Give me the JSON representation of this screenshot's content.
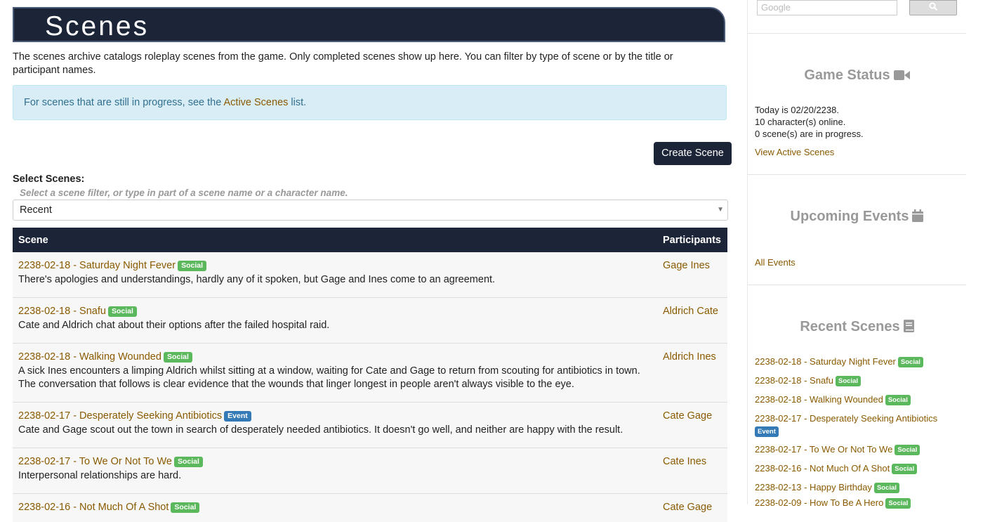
{
  "header": {
    "title": "Scenes"
  },
  "intro": "The scenes archive catalogs roleplay scenes from the game. Only completed scenes show up here. You can filter by type of scene or by the title or participant names.",
  "info": {
    "prefix": "For scenes that are still in progress, see the ",
    "link": "Active Scenes",
    "suffix": " list."
  },
  "create_button": "Create Scene",
  "filter": {
    "label": "Select Scenes:",
    "hint": "Select a scene filter, or type in part of a scene name or a character name.",
    "selected": "Recent"
  },
  "table": {
    "headers": {
      "scene": "Scene",
      "participants": "Participants"
    },
    "rows": [
      {
        "title": "2238-02-18 - Saturday Night Fever",
        "badge": "Social",
        "desc": "There's apologies and understandings, hardly any of it spoken, but Gage and Ines come to an agreement.",
        "participants": "Gage Ines"
      },
      {
        "title": "2238-02-18 - Snafu",
        "badge": "Social",
        "desc": "Cate and Aldrich chat about their options after the failed hospital raid.",
        "participants": "Aldrich Cate"
      },
      {
        "title": "2238-02-18 - Walking Wounded",
        "badge": "Social",
        "desc": "A sick Ines encounters a limping Aldrich whilst sitting at a window, waiting for Cate and Gage to return from scouting for antibiotics in town. The conversation that follows is clear evidence that the wounds that linger longest in people aren't always visible to the eye.",
        "participants": "Aldrich Ines"
      },
      {
        "title": "2238-02-17 - Desperately Seeking Antibiotics",
        "badge": "Event",
        "desc": "Cate and Gage scout out the town in search of desperately needed antibiotics. It doesn't go well, and neither are happy with the result.",
        "participants": "Cate Gage"
      },
      {
        "title": "2238-02-17 - To We Or Not To We",
        "badge": "Social",
        "desc": "Interpersonal relationships are hard.",
        "participants": "Cate Ines"
      },
      {
        "title": "2238-02-16 - Not Much Of A Shot",
        "badge": "Social",
        "desc": "",
        "participants": "Cate Gage"
      }
    ]
  },
  "sidebar": {
    "search_placeholder": "Google",
    "game_status": {
      "heading": "Game Status",
      "today": "Today is 02/20/2238.",
      "online": "10 character(s) online.",
      "in_progress": "0 scene(s) are in progress.",
      "link": "View Active Scenes"
    },
    "upcoming": {
      "heading": "Upcoming Events",
      "link": "All Events"
    },
    "recent": {
      "heading": "Recent Scenes",
      "items": [
        {
          "title": "2238-02-18 - Saturday Night Fever",
          "badge": "Social"
        },
        {
          "title": "2238-02-18 - Snafu",
          "badge": "Social"
        },
        {
          "title": "2238-02-18 - Walking Wounded",
          "badge": "Social"
        },
        {
          "title": "2238-02-17 - Desperately Seeking Antibiotics",
          "badge": "Event"
        },
        {
          "title": "2238-02-17 - To We Or Not To We",
          "badge": "Social"
        },
        {
          "title": "2238-02-16 - Not Much Of A Shot",
          "badge": "Social"
        },
        {
          "title": "2238-02-13 - Happy Birthday",
          "badge": "Social"
        },
        {
          "title": "2238-02-09 - How To Be A Hero",
          "badge": "Social"
        }
      ]
    }
  },
  "colors": {
    "navy": "#1c2538",
    "link": "#8a5a00",
    "social": "#5cb85c",
    "event": "#337ab7",
    "info_bg": "#d9edf7"
  }
}
